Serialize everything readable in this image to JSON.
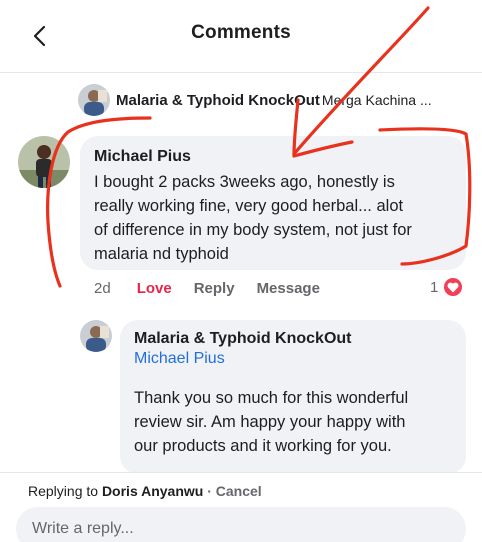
{
  "header": {
    "title": "Comments",
    "back_icon": "chevron-left-icon"
  },
  "post": {
    "page_name": "Malaria & Typhoid KnockOut",
    "snippet": "Merga Kachina ..."
  },
  "comment": {
    "author": "Michael Pius",
    "text": "I bought 2 packs 3weeks ago, honestly is\nreally working fine, very good herbal... alot\nof difference in my body system, not just for\nmalaria nd typhoid",
    "time": "2d",
    "love_label": "Love",
    "reply_label": "Reply",
    "message_label": "Message",
    "reaction_count": "1",
    "reaction_icon": "heart-icon"
  },
  "reply": {
    "author": "Malaria & Typhoid KnockOut",
    "mention": "Michael Pius",
    "text": "Thank you so much for this wonderful\nreview sir. Am happy your happy with\nour products and it working for you."
  },
  "composer": {
    "replying_prefix": "Replying to",
    "replying_name": "Doris Anyanwu",
    "separator": " · ",
    "cancel_label": "Cancel",
    "placeholder": "Write a reply..."
  },
  "colors": {
    "accent_link": "#216fdb",
    "love": "#e4264a",
    "annotation": "#e8321e"
  }
}
